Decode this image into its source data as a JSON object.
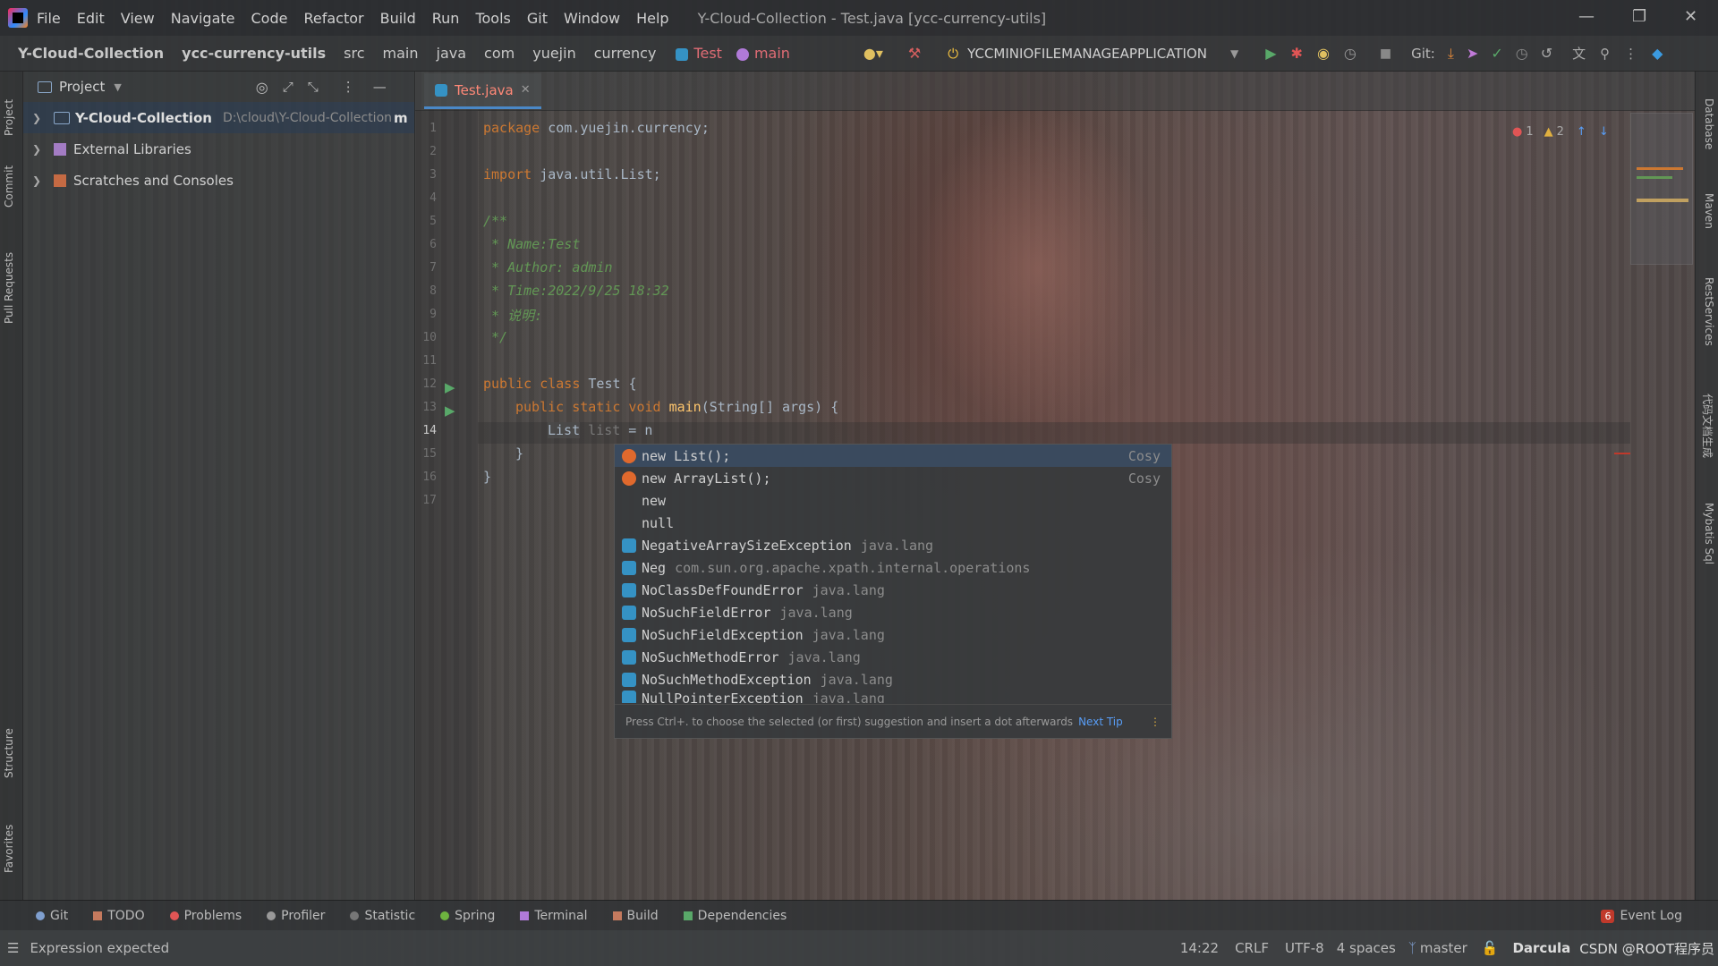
{
  "titlebar": {
    "menu": [
      "File",
      "Edit",
      "View",
      "Navigate",
      "Code",
      "Refactor",
      "Build",
      "Run",
      "Tools",
      "Git",
      "Window",
      "Help"
    ],
    "window_title": "Y-Cloud-Collection - Test.java [ycc-currency-utils]"
  },
  "navbar": {
    "crumbs": [
      "Y-Cloud-Collection",
      "ycc-currency-utils",
      "src",
      "main",
      "java",
      "com",
      "yuejin",
      "currency"
    ],
    "test_label": "Test",
    "main_label": "main",
    "run_config": "YCCMINIOFILEMANAGEAPPLICATION",
    "git_label": "Git:"
  },
  "left_tabs": [
    "Project",
    "Commit",
    "Pull Requests",
    "Structure",
    "Favorites"
  ],
  "right_tabs": [
    "Database",
    "Maven",
    "RestServices",
    "代码文档生成",
    "Mybatis Sql"
  ],
  "project": {
    "header": "Project",
    "items": [
      {
        "label": "Y-Cloud-Collection",
        "path": "D:\\cloud\\Y-Cloud-Collection",
        "suffix": "m"
      },
      {
        "label": "External Libraries"
      },
      {
        "label": "Scratches and Consoles"
      }
    ]
  },
  "editor": {
    "tab_label": "Test.java",
    "error_count": "1",
    "warning_count": "2",
    "lines": [
      "1",
      "2",
      "3",
      "4",
      "5",
      "6",
      "7",
      "8",
      "9",
      "10",
      "11",
      "12",
      "13",
      "14",
      "15",
      "16",
      "17"
    ],
    "current_line": "14",
    "code": {
      "package": "package",
      "package_name": " com.yuejin.currency;",
      "import": "import",
      "import_name": " java.util.List;",
      "doc_open": "/**",
      "doc_name": " * Name:Test",
      "doc_author": " * Author: admin",
      "doc_time": " * Time:2022/9/25 18:32",
      "doc_desc": " * 说明:",
      "doc_close": " */",
      "class_kw": "public class",
      "class_name": " Test {",
      "method_kw": "public static void",
      "method_name": " main",
      "method_args": "(String[] args) {",
      "decl_type": "List",
      "decl_var": " list",
      "decl_assign": " = n",
      "close_inner": "}",
      "close_outer": "}"
    }
  },
  "completion": {
    "items": [
      {
        "text": "new List();",
        "right": "Cosy",
        "icon": "orange"
      },
      {
        "text": "new ArrayList();",
        "right": "Cosy",
        "icon": "orange"
      },
      {
        "text": "new",
        "icon": "none"
      },
      {
        "text": "null",
        "icon": "none"
      },
      {
        "text": "NegativeArraySizeException",
        "pkg": "java.lang",
        "icon": "blue"
      },
      {
        "text": "Neg",
        "pkg": "com.sun.org.apache.xpath.internal.operations",
        "icon": "blue"
      },
      {
        "text": "NoClassDefFoundError",
        "pkg": "java.lang",
        "icon": "blue"
      },
      {
        "text": "NoSuchFieldError",
        "pkg": "java.lang",
        "icon": "blue"
      },
      {
        "text": "NoSuchFieldException",
        "pkg": "java.lang",
        "icon": "blue"
      },
      {
        "text": "NoSuchMethodError",
        "pkg": "java.lang",
        "icon": "blue"
      },
      {
        "text": "NoSuchMethodException",
        "pkg": "java.lang",
        "icon": "blue"
      },
      {
        "text": "NullPointerException",
        "pkg": "java.lang",
        "icon": "blue"
      }
    ],
    "hint": "Press Ctrl+. to choose the selected (or first) suggestion and insert a dot afterwards",
    "hint_link": "Next Tip"
  },
  "bottom_tabs": [
    "Git",
    "TODO",
    "Problems",
    "Profiler",
    "Statistic",
    "Spring",
    "Terminal",
    "Build",
    "Dependencies"
  ],
  "event_log": {
    "count": "6",
    "label": "Event Log"
  },
  "status": {
    "message": "Expression expected",
    "position": "14:22",
    "line_sep": "CRLF",
    "encoding": "UTF-8",
    "indent": "4 spaces",
    "branch": "master",
    "theme": "Darcula",
    "watermark": "CSDN @ROOT程序员"
  },
  "colors": {
    "accent": "#4a88c7",
    "keyword": "#cc7832",
    "comment": "#629755",
    "function": "#ffc66d"
  }
}
